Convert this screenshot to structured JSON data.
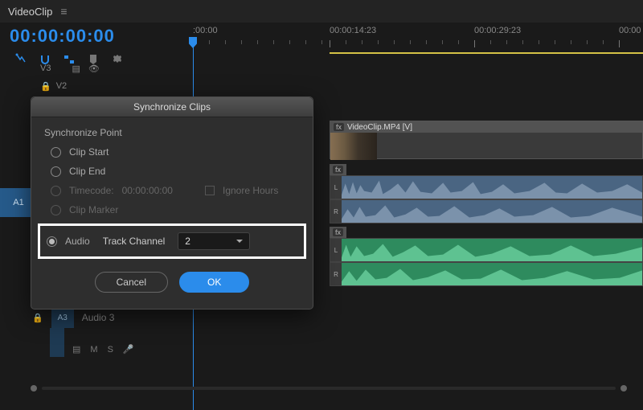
{
  "sequence_name": "VideoClip",
  "current_timecode": "00:00:00:00",
  "ruler": {
    "labels": [
      {
        "text": ":00:00",
        "pos": 0
      },
      {
        "text": "00:00:14:23",
        "pos": 170
      },
      {
        "text": "00:00:29:23",
        "pos": 350
      },
      {
        "text": "00:00",
        "pos": 530
      }
    ]
  },
  "tracks": {
    "v3": "V3",
    "v2": "V2",
    "a1": "A1",
    "a3": "A3",
    "a3_label": "Audio 3"
  },
  "clip": {
    "name": "VideoClip.MP4 [V]",
    "fx": "fx"
  },
  "footer_icons": [
    "M",
    "S"
  ],
  "dialog": {
    "title": "Synchronize Clips",
    "section": "Synchronize Point",
    "options": {
      "clip_start": "Clip Start",
      "clip_end": "Clip End",
      "timecode": "Timecode:",
      "timecode_value": "00:00:00:00",
      "ignore_hours": "Ignore Hours",
      "clip_marker": "Clip Marker",
      "audio": "Audio",
      "track_channel_label": "Track Channel",
      "track_channel_value": "2"
    },
    "buttons": {
      "cancel": "Cancel",
      "ok": "OK"
    }
  }
}
